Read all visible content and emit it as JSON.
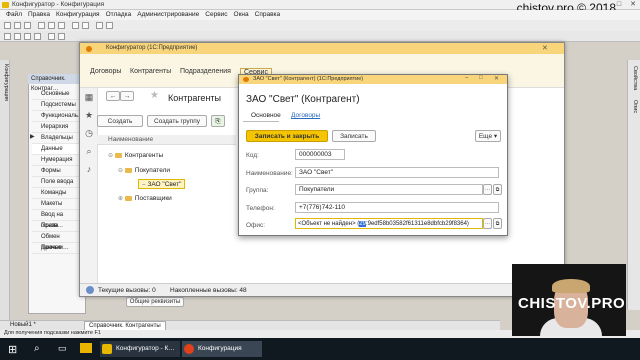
{
  "configurator": {
    "title": "Конфигуратор - Конфигурация",
    "menu": [
      "Файл",
      "Правка",
      "Конфигурация",
      "Отладка",
      "Администрирование",
      "Сервис",
      "Окна",
      "Справка"
    ],
    "brand_text": "chistov.pro © 2018",
    "tree_header": "Справочник. Контраг…",
    "tree_items": [
      "Основные",
      "Подсистемы",
      "Функциональ…",
      "Иерархия",
      "Владельцы",
      "Данные",
      "Нумерация",
      "Формы",
      "Поле ввода",
      "Команды",
      "Макеты",
      "Ввод на основ…",
      "Права",
      "Обмен данным…",
      "Прочее"
    ],
    "tree_selected": "Данные",
    "common_requisites_button": "Общие реквизиты",
    "right_tabs": [
      "Свойства",
      "Опис"
    ],
    "left_tabs": [
      "Конфигурация"
    ],
    "bottom_tabs": [
      "Новый1 *",
      "Справочник. Контрагенты"
    ],
    "status": "Для получения подсказки нажмите F1"
  },
  "enterprise": {
    "title": "Конфигуратор (1С:Предприятие)",
    "sections": [
      "Договоры",
      "Контрагенты",
      "Подразделения",
      "Сервис"
    ],
    "list_title": "Контрагенты",
    "create_button": "Создать",
    "create_group_button": "Создать группу",
    "list_column": "Наименование",
    "tree": [
      {
        "label": "Контрагенты",
        "level": 0
      },
      {
        "label": "Покупатели",
        "level": 1
      },
      {
        "label": "ЗАО \"Свет\"",
        "level": 2
      },
      {
        "label": "Поставщики",
        "level": 1
      }
    ],
    "current_calls": "Текущие вызовы: 0",
    "accumulated_calls": "Накопленные вызовы: 48"
  },
  "form": {
    "window_title": "ЗАО \"Свет\" (Контрагент) (1С:Предприятие)",
    "heading": "ЗАО \"Свет\" (Контрагент)",
    "tabs": [
      "Основное",
      "Договоры"
    ],
    "save_close_button": "Записать и закрыть",
    "save_button": "Записать",
    "more_button": "Еще",
    "fields": {
      "code": {
        "label": "Код:",
        "value": "000000003"
      },
      "name": {
        "label": "Наименование:",
        "value": "ЗАО \"Свет\""
      },
      "group": {
        "label": "Группа:",
        "value": "Покупатели"
      },
      "phone": {
        "label": "Телефон:",
        "value": "+7(776)742-110"
      },
      "office": {
        "label": "Офис:",
        "value_prefix": "<Объект не найден> (",
        "value_selected": "29",
        "value_suffix": ":9edf58b03582f61311e8dbfcb29f8364)"
      }
    }
  },
  "taskbar": {
    "items": [
      "Конфигуратор - К…",
      "Конфигурация"
    ]
  },
  "webcam": {
    "watermark": "CHISTOV.PRO"
  },
  "colors": {
    "accent_yellow": "#f8d57a",
    "save_button": "#f5c400",
    "link_blue": "#2a6bc0"
  }
}
